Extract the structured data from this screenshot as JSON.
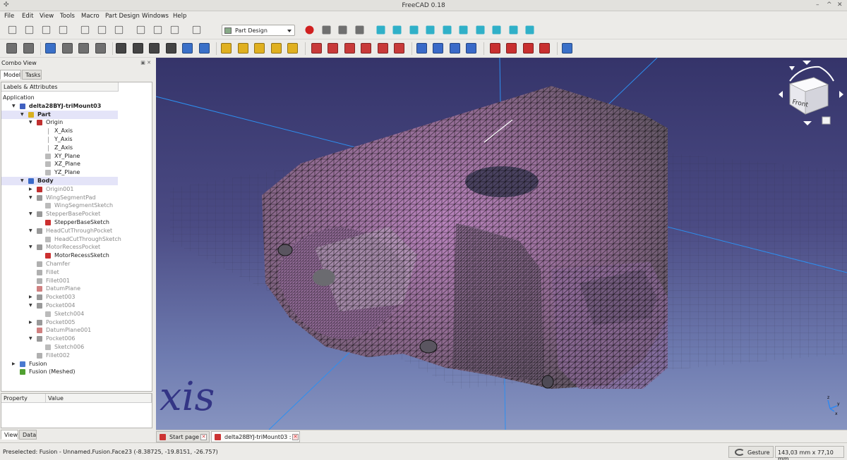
{
  "window": {
    "title": "FreeCAD 0.18"
  },
  "menu": [
    "File",
    "Edit",
    "View",
    "Tools",
    "Macro",
    "Part Design",
    "Windows",
    "Help"
  ],
  "workbench": {
    "selected": "Part Design"
  },
  "combo": {
    "title": "Combo View",
    "tabs": [
      "Model",
      "Tasks"
    ],
    "tree_header": "Labels & Attributes",
    "property_tabs": [
      "View",
      "Data"
    ],
    "property_headers": [
      "Property",
      "Value"
    ]
  },
  "tree": [
    {
      "label": "Application",
      "depth": 0,
      "arrow": "",
      "icon": "none"
    },
    {
      "label": "delta28BYJ-triMount03",
      "depth": 1,
      "arrow": "▼",
      "icon": "document-icon",
      "bold": true
    },
    {
      "label": "Part",
      "depth": 2,
      "arrow": "▼",
      "icon": "part-icon",
      "bold": true,
      "selected": true
    },
    {
      "label": "Origin",
      "depth": 3,
      "arrow": "▼",
      "icon": "origin-icon"
    },
    {
      "label": "X_Axis",
      "depth": 4,
      "arrow": "",
      "icon": "axis-icon"
    },
    {
      "label": "Y_Axis",
      "depth": 4,
      "arrow": "",
      "icon": "axis-icon"
    },
    {
      "label": "Z_Axis",
      "depth": 4,
      "arrow": "",
      "icon": "axis-icon"
    },
    {
      "label": "XY_Plane",
      "depth": 4,
      "arrow": "",
      "icon": "plane-icon"
    },
    {
      "label": "XZ_Plane",
      "depth": 4,
      "arrow": "",
      "icon": "plane-icon"
    },
    {
      "label": "YZ_Plane",
      "depth": 4,
      "arrow": "",
      "icon": "plane-icon"
    },
    {
      "label": "Body",
      "depth": 2,
      "arrow": "▼",
      "icon": "body-icon",
      "bold": true,
      "selected": true
    },
    {
      "label": "Origin001",
      "depth": 3,
      "arrow": "▶",
      "icon": "origin-icon",
      "dim": true
    },
    {
      "label": "WingSegmentPad",
      "depth": 3,
      "arrow": "▼",
      "icon": "pad-icon",
      "dim": true
    },
    {
      "label": "WingSegmentSketch",
      "depth": 4,
      "arrow": "",
      "icon": "sketch-icon",
      "dim": true
    },
    {
      "label": "StepperBasePocket",
      "depth": 3,
      "arrow": "▼",
      "icon": "pocket-icon",
      "dim": true
    },
    {
      "label": "StepperBaseSketch",
      "depth": 4,
      "arrow": "",
      "icon": "sketch-red-icon"
    },
    {
      "label": "HeadCutThroughPocket",
      "depth": 3,
      "arrow": "▼",
      "icon": "pocket-icon",
      "dim": true
    },
    {
      "label": "HeadCutThroughSketch",
      "depth": 4,
      "arrow": "",
      "icon": "sketch-icon",
      "dim": true
    },
    {
      "label": "MotorRecessPocket",
      "depth": 3,
      "arrow": "▼",
      "icon": "pocket-icon",
      "dim": true
    },
    {
      "label": "MotorRecessSketch",
      "depth": 4,
      "arrow": "",
      "icon": "sketch-red-icon"
    },
    {
      "label": "Chamfer",
      "depth": 3,
      "arrow": "",
      "icon": "chamfer-icon",
      "dim": true
    },
    {
      "label": "Fillet",
      "depth": 3,
      "arrow": "",
      "icon": "fillet-icon",
      "dim": true
    },
    {
      "label": "Fillet001",
      "depth": 3,
      "arrow": "",
      "icon": "fillet-icon",
      "dim": true
    },
    {
      "label": "DatumPlane",
      "depth": 3,
      "arrow": "",
      "icon": "datum-plane-icon",
      "dim": true
    },
    {
      "label": "Pocket003",
      "depth": 3,
      "arrow": "▶",
      "icon": "pocket-icon",
      "dim": true
    },
    {
      "label": "Pocket004",
      "depth": 3,
      "arrow": "▼",
      "icon": "pocket-icon",
      "dim": true
    },
    {
      "label": "Sketch004",
      "depth": 4,
      "arrow": "",
      "icon": "sketch-icon",
      "dim": true
    },
    {
      "label": "Pocket005",
      "depth": 3,
      "arrow": "▶",
      "icon": "pocket-icon",
      "dim": true
    },
    {
      "label": "DatumPlane001",
      "depth": 3,
      "arrow": "",
      "icon": "datum-plane-icon",
      "dim": true
    },
    {
      "label": "Pocket006",
      "depth": 3,
      "arrow": "▼",
      "icon": "pocket-icon",
      "dim": true
    },
    {
      "label": "Sketch006",
      "depth": 4,
      "arrow": "",
      "icon": "sketch-icon",
      "dim": true
    },
    {
      "label": "Fillet002",
      "depth": 3,
      "arrow": "",
      "icon": "fillet-icon",
      "dim": true
    },
    {
      "label": "Fusion",
      "depth": 1,
      "arrow": "▶",
      "icon": "fusion-icon"
    },
    {
      "label": "Fusion (Meshed)",
      "depth": 1,
      "arrow": "",
      "icon": "mesh-icon"
    }
  ],
  "viewport": {
    "navcube_label": "Front",
    "watermark": "xis"
  },
  "doc_tabs": [
    "Start page",
    "delta28BYJ-triMount03 : 1"
  ],
  "status": {
    "message": "Preselected: Fusion - Unnamed.Fusion.Face23 (-8.38725, -19.8151, -26.757)",
    "nav_style": "Gesture",
    "dimensions": "143,03 mm x 77,10 mm"
  },
  "toolbar_icons": {
    "row1": [
      "new-icon",
      "open-icon",
      "save-icon",
      "print-icon",
      "cut-icon",
      "copy-icon",
      "paste-icon",
      "undo-icon",
      "redo-icon",
      "refresh-icon",
      "whats-this-icon",
      "record-macro-icon",
      "stop-macro-icon",
      "macros-icon",
      "execute-macro-icon",
      "fit-all-icon",
      "fit-selection-icon",
      "view-isometric-icon",
      "view-front-icon",
      "view-top-icon",
      "view-right-icon",
      "view-rear-icon",
      "view-bottom-icon",
      "view-left-icon",
      "measure-icon"
    ],
    "row2": [
      "create-part-icon",
      "create-group-icon",
      "create-body-icon",
      "create-sketch-icon",
      "validate-sketch-icon",
      "map-sketch-icon",
      "point-icon",
      "line-icon",
      "datum-plane-icon",
      "local-cs-icon",
      "shape-binder-icon",
      "clone-icon",
      "pad-icon",
      "revolution-icon",
      "additive-loft-icon",
      "additive-pipe-icon",
      "additive-primitive-icon",
      "pocket-icon",
      "hole-icon",
      "groove-icon",
      "subtractive-loft-icon",
      "subtractive-pipe-icon",
      "subtractive-primitive-icon",
      "mirrored-icon",
      "linear-pattern-icon",
      "polar-pattern-icon",
      "multitransform-icon",
      "fillet-icon",
      "chamfer-icon",
      "draft-icon",
      "thickness-icon",
      "boolean-icon"
    ]
  },
  "colors": {
    "accent_red": "#cc2222",
    "viewport_top": "#35346a",
    "viewport_bottom": "#8794c0",
    "model_mauve": "#b277b9"
  }
}
